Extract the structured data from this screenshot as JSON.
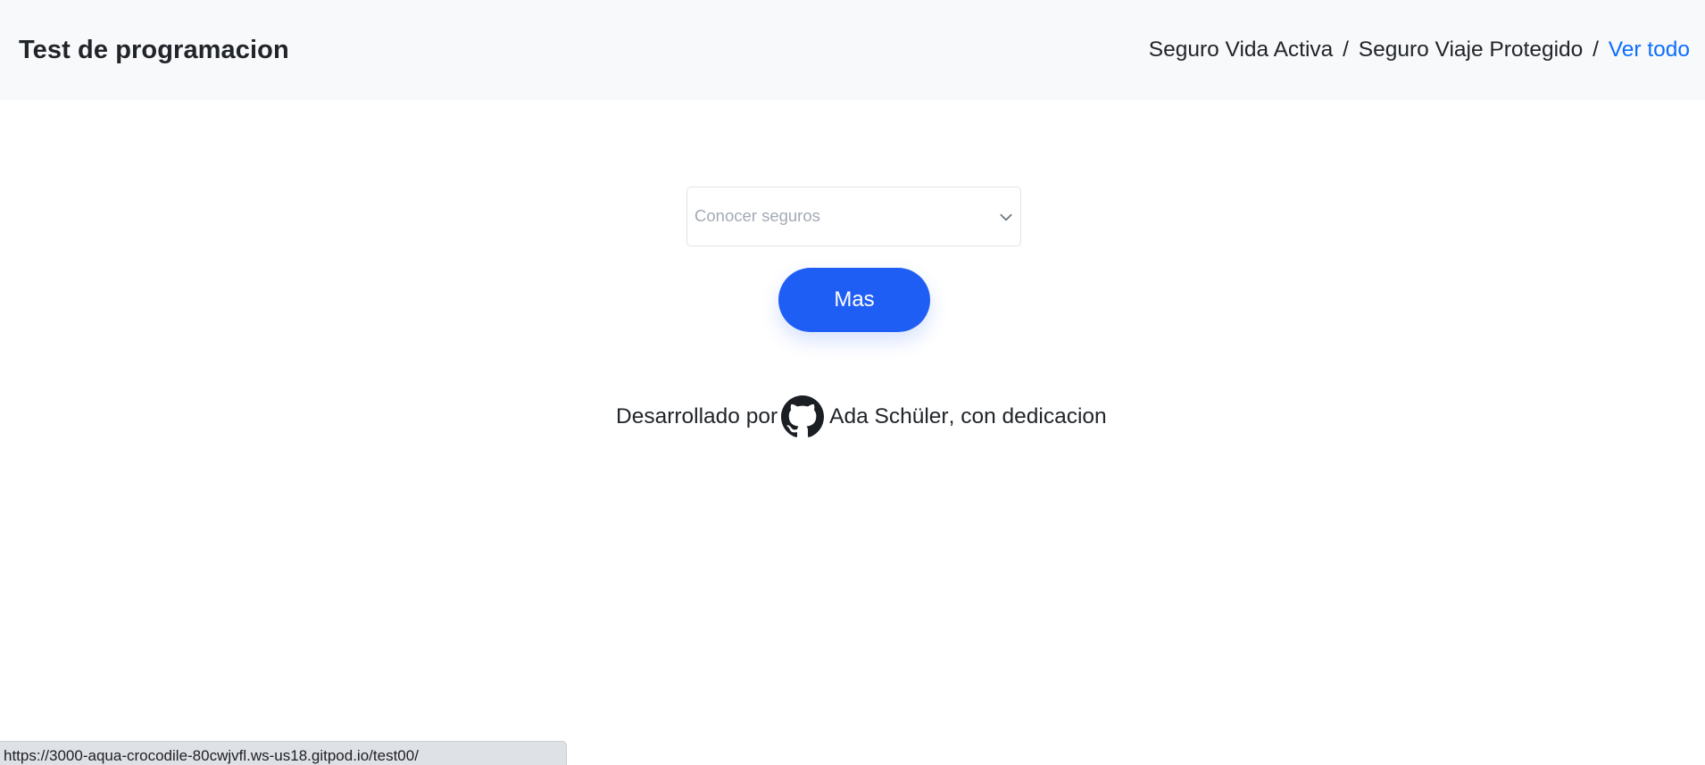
{
  "navbar": {
    "brand": "Test de programacion",
    "breadcrumb": {
      "item1": "Seguro Vida Activa",
      "separator": "/",
      "item2": "Seguro Viaje Protegido",
      "link": "Ver todo"
    }
  },
  "form": {
    "select_placeholder": "Conocer seguros",
    "button_label": "Mas"
  },
  "footer_credit": {
    "prefix": "Desarrollado por",
    "icon": "github-icon",
    "author": "Ada Schüler",
    "suffix": ", con dedicacion"
  },
  "status_bar": {
    "url": "https://3000-aqua-crocodile-80cwjvfl.ws-us18.gitpod.io/test00/"
  },
  "colors": {
    "navbar_bg": "#f8f9fa",
    "link": "#0d6efd",
    "button": "#1f5ef5",
    "placeholder": "#a3aab5"
  }
}
